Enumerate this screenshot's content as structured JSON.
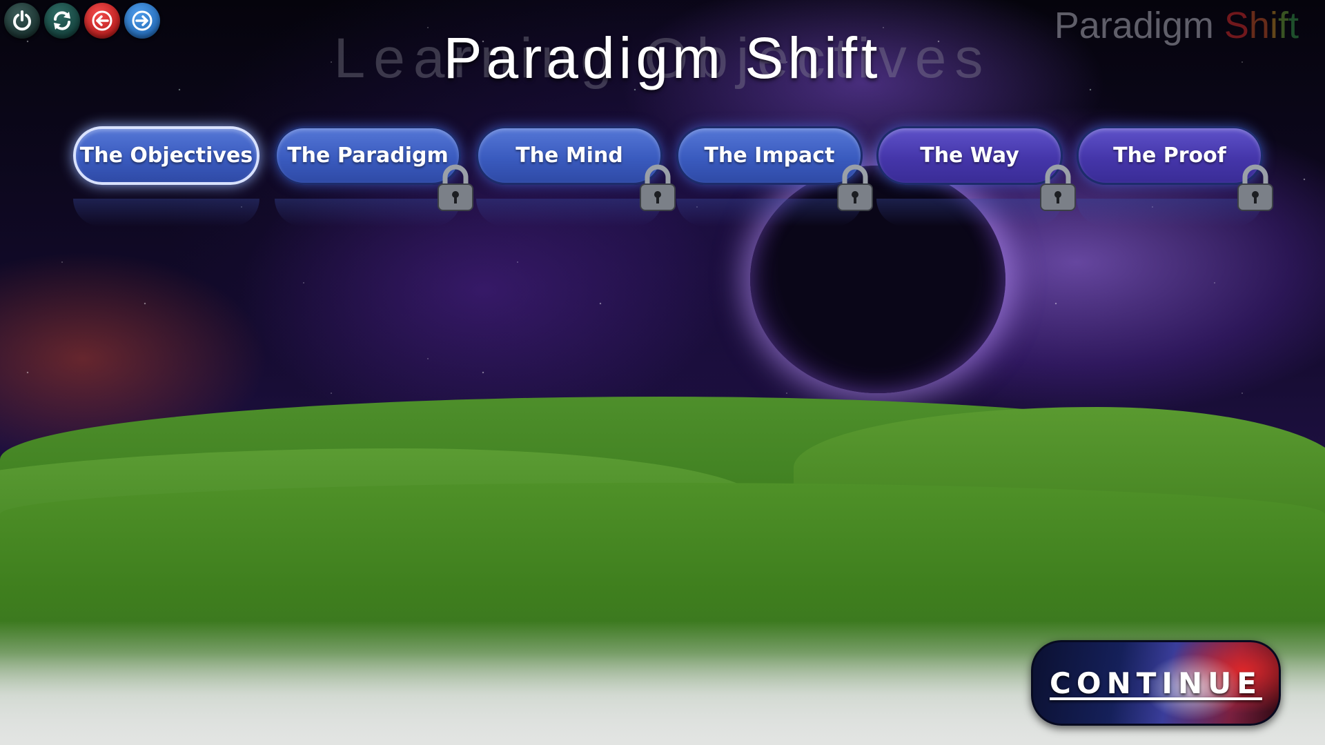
{
  "header": {
    "ghost_title": "Learning Objectives",
    "title": "Paradigm Shift"
  },
  "brand": {
    "part1": "Paradigm ",
    "s": "S",
    "h": "h",
    "i": "i",
    "f": "f",
    "t": "t"
  },
  "controls": [
    {
      "name": "power",
      "icon": "power-icon"
    },
    {
      "name": "refresh",
      "icon": "refresh-icon"
    },
    {
      "name": "back",
      "icon": "back-arrow-icon",
      "color": "#d01c1c"
    },
    {
      "name": "forward",
      "icon": "forward-arrow-icon",
      "color": "#2a75c9"
    }
  ],
  "nav": {
    "items": [
      {
        "label": "The Objectives",
        "locked": false,
        "active": true
      },
      {
        "label": "The Paradigm",
        "locked": true,
        "active": false
      },
      {
        "label": "The Mind",
        "locked": true,
        "active": false
      },
      {
        "label": "The Impact",
        "locked": true,
        "active": false
      },
      {
        "label": "The Way",
        "locked": true,
        "active": false
      },
      {
        "label": "The Proof",
        "locked": true,
        "active": false
      }
    ]
  },
  "continue_button": {
    "label": "CONTINUE"
  },
  "colors": {
    "pill_blue": "#3a5bbf",
    "pill_purple": "#4536aa",
    "grass": "#3f7f1e",
    "sky": "#120a2a"
  }
}
